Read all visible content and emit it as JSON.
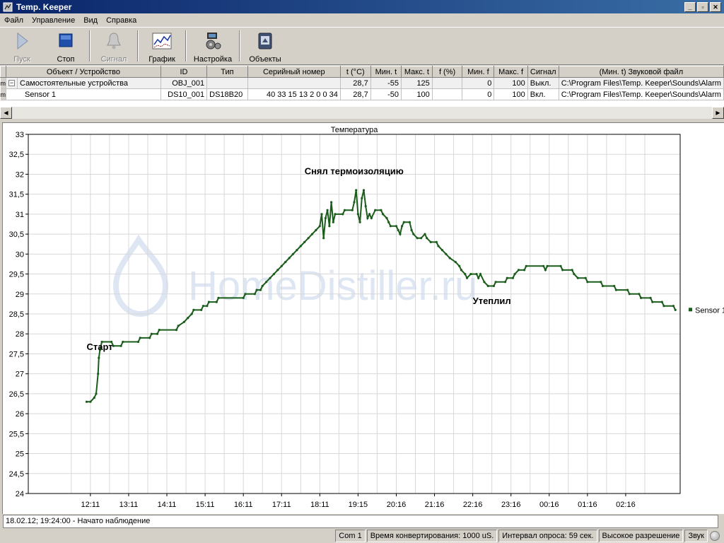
{
  "window": {
    "title": "Temp. Keeper",
    "btn_min": "_",
    "btn_max": "▫",
    "btn_close": "✕"
  },
  "menu": [
    "Файл",
    "Управление",
    "Вид",
    "Справка"
  ],
  "toolbar": {
    "start": "Пуск",
    "stop": "Стоп",
    "signal": "Сигнал",
    "graph": "График",
    "settings": "Настройка",
    "objects": "Объекты"
  },
  "table": {
    "headers": [
      "Объект / Устройство",
      "ID",
      "Тип",
      "Серийный номер",
      "t (°C)",
      "Мин. t",
      "Макс. t",
      "f (%)",
      "Мин. f",
      "Макс. f",
      "Сигнал",
      "(Мин. t) Звуковой файл"
    ],
    "rows": [
      {
        "expand": "−",
        "name": "Самостоятельные устройства",
        "id": "OBJ_001",
        "type": "",
        "serial": "",
        "t": "28,7",
        "min_t": "-55",
        "max_t": "125",
        "f": "",
        "min_f": "0",
        "max_f": "100",
        "signal": "Выкл.",
        "file": "C:\\Program Files\\Temp. Keeper\\Sounds\\Alarm"
      },
      {
        "expand": "",
        "name": "Sensor 1",
        "id": "DS10_001",
        "type": "DS18B20",
        "serial": "40 33 15 13 2 0 0 34",
        "t": "28,7",
        "min_t": "-50",
        "max_t": "100",
        "f": "",
        "min_f": "0",
        "max_f": "100",
        "signal": "Вкл.",
        "file": "C:\\Program Files\\Temp. Keeper\\Sounds\\Alarm"
      }
    ],
    "left_marks": [
      "m",
      "m"
    ]
  },
  "chart_data": {
    "type": "line",
    "title": "Температура",
    "xlabel": "",
    "ylabel": "",
    "ylim": [
      24,
      33
    ],
    "y_ticks": [
      "24",
      "24,5",
      "25",
      "25,5",
      "26",
      "26,5",
      "27",
      "27,5",
      "28",
      "28,5",
      "29",
      "29,5",
      "30",
      "30,5",
      "31",
      "31,5",
      "32",
      "32,5",
      "33"
    ],
    "x_ticks": [
      "12:11",
      "13:11",
      "14:11",
      "15:11",
      "16:11",
      "17:11",
      "18:11",
      "19:15",
      "20:16",
      "21:16",
      "22:16",
      "23:16",
      "00:16",
      "01:16",
      "02:16"
    ],
    "grid": true,
    "legend": "right",
    "series_color": "#1a5c1a",
    "series": [
      {
        "name": "Sensor 1",
        "points": [
          [
            -0.1,
            26.3
          ],
          [
            0.0,
            26.3
          ],
          [
            0.1,
            26.4
          ],
          [
            0.15,
            26.5
          ],
          [
            0.2,
            27.0
          ],
          [
            0.22,
            27.4
          ],
          [
            0.25,
            27.6
          ],
          [
            0.3,
            27.8
          ],
          [
            0.55,
            27.8
          ],
          [
            0.6,
            27.7
          ],
          [
            0.8,
            27.7
          ],
          [
            0.85,
            27.8
          ],
          [
            1.25,
            27.8
          ],
          [
            1.3,
            27.9
          ],
          [
            1.55,
            27.9
          ],
          [
            1.6,
            28.0
          ],
          [
            1.75,
            28.0
          ],
          [
            1.8,
            28.1
          ],
          [
            2.25,
            28.1
          ],
          [
            2.3,
            28.2
          ],
          [
            2.45,
            28.3
          ],
          [
            2.55,
            28.4
          ],
          [
            2.65,
            28.5
          ],
          [
            2.7,
            28.6
          ],
          [
            2.9,
            28.6
          ],
          [
            2.95,
            28.7
          ],
          [
            3.05,
            28.7
          ],
          [
            3.1,
            28.8
          ],
          [
            3.3,
            28.8
          ],
          [
            3.35,
            28.9
          ],
          [
            4.0,
            28.9
          ],
          [
            4.05,
            29.0
          ],
          [
            4.3,
            29.0
          ],
          [
            4.35,
            29.1
          ],
          [
            4.45,
            29.1
          ],
          [
            4.5,
            29.2
          ],
          [
            4.6,
            29.3
          ],
          [
            4.7,
            29.4
          ],
          [
            4.8,
            29.5
          ],
          [
            4.9,
            29.6
          ],
          [
            5.0,
            29.7
          ],
          [
            5.1,
            29.8
          ],
          [
            5.2,
            29.9
          ],
          [
            5.3,
            30.0
          ],
          [
            5.4,
            30.1
          ],
          [
            5.5,
            30.2
          ],
          [
            5.6,
            30.3
          ],
          [
            5.7,
            30.4
          ],
          [
            5.8,
            30.5
          ],
          [
            5.9,
            30.6
          ],
          [
            6.0,
            30.7
          ],
          [
            6.05,
            31.0
          ],
          [
            6.1,
            30.4
          ],
          [
            6.15,
            30.9
          ],
          [
            6.2,
            31.1
          ],
          [
            6.25,
            30.7
          ],
          [
            6.3,
            31.3
          ],
          [
            6.35,
            30.8
          ],
          [
            6.4,
            31.0
          ],
          [
            6.6,
            31.0
          ],
          [
            6.65,
            31.1
          ],
          [
            6.85,
            31.1
          ],
          [
            6.9,
            31.3
          ],
          [
            6.95,
            31.6
          ],
          [
            7.0,
            31.0
          ],
          [
            7.05,
            30.8
          ],
          [
            7.1,
            31.4
          ],
          [
            7.15,
            31.6
          ],
          [
            7.2,
            31.2
          ],
          [
            7.25,
            30.9
          ],
          [
            7.3,
            31.0
          ],
          [
            7.35,
            30.9
          ],
          [
            7.45,
            31.1
          ],
          [
            7.6,
            31.1
          ],
          [
            7.65,
            31.0
          ],
          [
            7.75,
            30.9
          ],
          [
            7.8,
            30.8
          ],
          [
            7.85,
            30.7
          ],
          [
            8.0,
            30.7
          ],
          [
            8.05,
            30.6
          ],
          [
            8.1,
            30.5
          ],
          [
            8.15,
            30.7
          ],
          [
            8.2,
            30.8
          ],
          [
            8.35,
            30.8
          ],
          [
            8.4,
            30.6
          ],
          [
            8.45,
            30.5
          ],
          [
            8.55,
            30.4
          ],
          [
            8.65,
            30.4
          ],
          [
            8.75,
            30.5
          ],
          [
            8.8,
            30.4
          ],
          [
            8.9,
            30.3
          ],
          [
            9.05,
            30.3
          ],
          [
            9.1,
            30.2
          ],
          [
            9.2,
            30.1
          ],
          [
            9.3,
            30.0
          ],
          [
            9.4,
            29.9
          ],
          [
            9.55,
            29.8
          ],
          [
            9.65,
            29.7
          ],
          [
            9.7,
            29.6
          ],
          [
            9.8,
            29.5
          ],
          [
            9.85,
            29.4
          ],
          [
            9.95,
            29.5
          ],
          [
            10.1,
            29.5
          ],
          [
            10.15,
            29.4
          ],
          [
            10.2,
            29.5
          ],
          [
            10.3,
            29.3
          ],
          [
            10.4,
            29.2
          ],
          [
            10.55,
            29.2
          ],
          [
            10.6,
            29.3
          ],
          [
            10.85,
            29.3
          ],
          [
            10.9,
            29.4
          ],
          [
            11.05,
            29.4
          ],
          [
            11.1,
            29.5
          ],
          [
            11.2,
            29.6
          ],
          [
            11.35,
            29.6
          ],
          [
            11.4,
            29.7
          ],
          [
            11.85,
            29.7
          ],
          [
            11.9,
            29.6
          ],
          [
            11.95,
            29.7
          ],
          [
            12.3,
            29.7
          ],
          [
            12.35,
            29.6
          ],
          [
            12.6,
            29.6
          ],
          [
            12.65,
            29.5
          ],
          [
            12.75,
            29.4
          ],
          [
            12.95,
            29.4
          ],
          [
            13.0,
            29.3
          ],
          [
            13.35,
            29.3
          ],
          [
            13.4,
            29.2
          ],
          [
            13.7,
            29.2
          ],
          [
            13.75,
            29.1
          ],
          [
            14.05,
            29.1
          ],
          [
            14.1,
            29.0
          ],
          [
            14.35,
            29.0
          ],
          [
            14.4,
            28.9
          ],
          [
            14.65,
            28.9
          ],
          [
            14.7,
            28.8
          ],
          [
            14.95,
            28.8
          ],
          [
            15.0,
            28.7
          ],
          [
            15.25,
            28.7
          ],
          [
            15.3,
            28.6
          ]
        ]
      }
    ],
    "annotations": [
      {
        "text": "Старт",
        "x": -0.1,
        "y": 27.6
      },
      {
        "text": "Снял термоизоляцию",
        "x": 5.6,
        "y": 32.0
      },
      {
        "text": "Утеплил",
        "x": 10.0,
        "y": 28.75
      }
    ]
  },
  "watermark": "HomeDistiller.ru",
  "log": "18.02.12; 19:24:00 - Начато наблюдение",
  "status": {
    "port": "Com 1",
    "conversion": "Время конвертирования: 1000 uS.",
    "poll": "Интервал опроса: 59 сек.",
    "resolution": "Высокое разрешение",
    "sound": "Звук"
  }
}
